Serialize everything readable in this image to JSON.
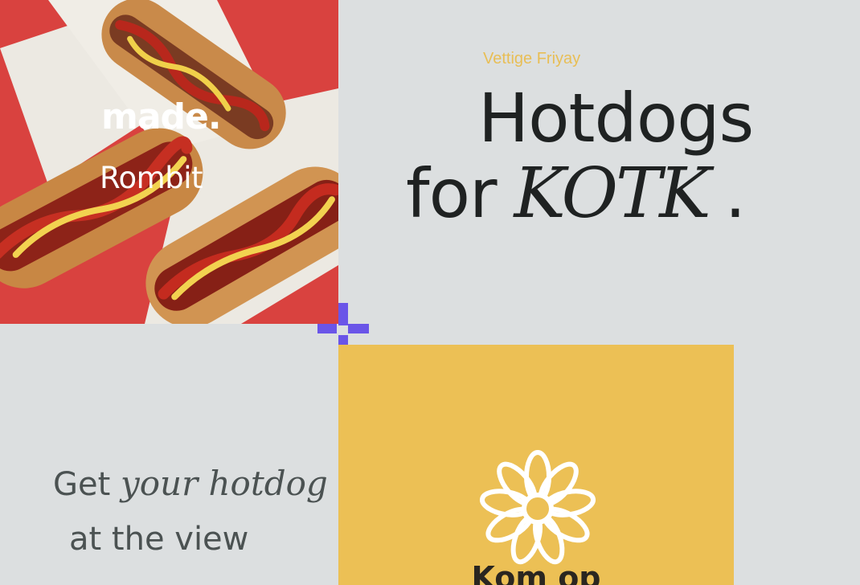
{
  "hero": {
    "logo_made": "made.",
    "logo_rombit": "Rombit"
  },
  "intro": {
    "eyebrow": "Vettige Friyay",
    "headline_line1": "Hotdogs",
    "headline_for": "for",
    "headline_emphasis": "KOTK",
    "headline_dot": "."
  },
  "tagline": {
    "get": "Get",
    "emphasis": "your hotdog",
    "line2": "at the view"
  },
  "card": {
    "heading": "Kom op"
  },
  "colors": {
    "background": "#dcdfe0",
    "accent_yellow": "#ecc055",
    "eyebrow_yellow": "#e8be55",
    "sparkle_purple": "#6a55e8",
    "photo_red": "#d9423f"
  },
  "icons": [
    "sparkle-icon",
    "flower-icon"
  ]
}
